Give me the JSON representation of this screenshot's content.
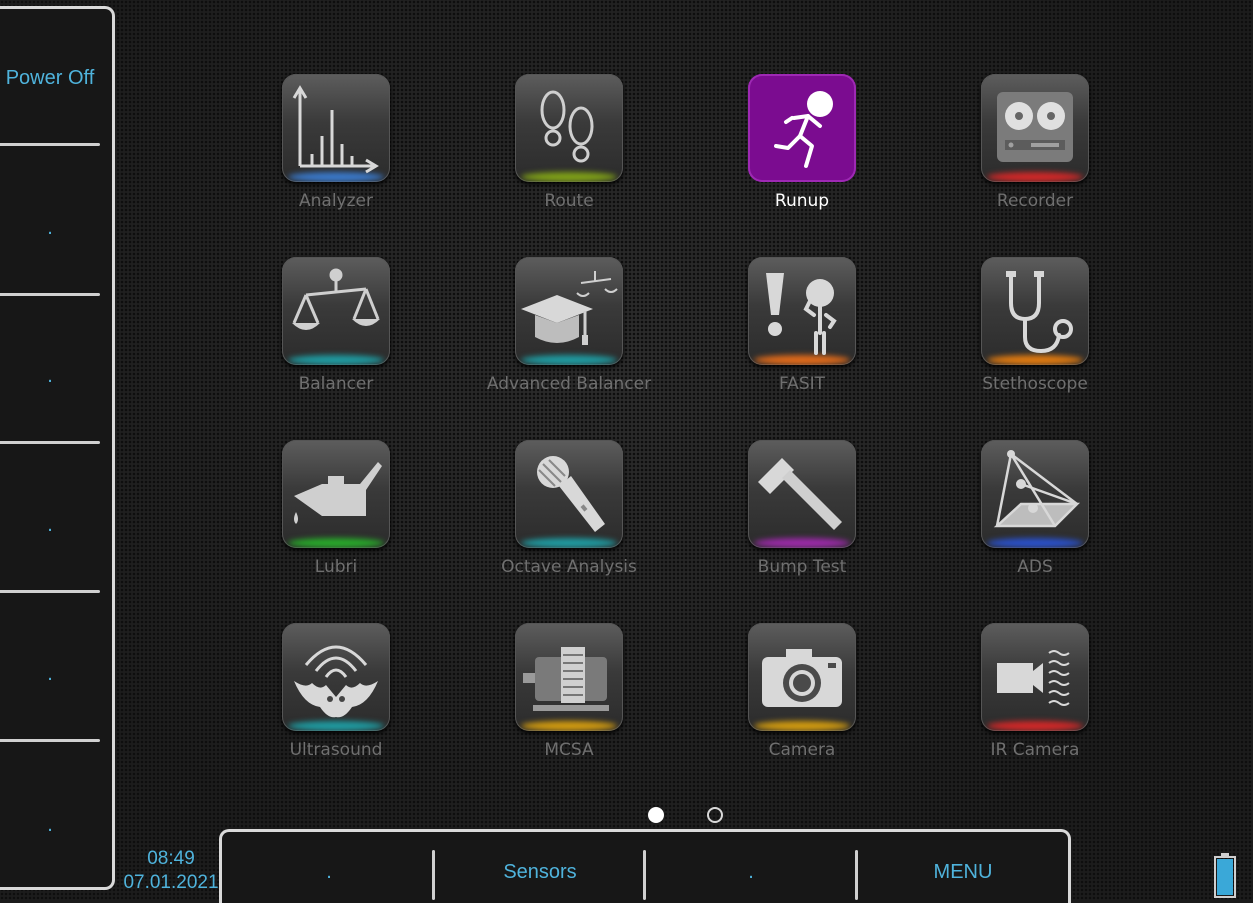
{
  "left_softkeys": [
    {
      "label": "Power Off"
    },
    {
      "label": "."
    },
    {
      "label": "."
    },
    {
      "label": "."
    },
    {
      "label": "."
    },
    {
      "label": "."
    }
  ],
  "apps": [
    {
      "label": "Analyzer",
      "icon": "spectrum-chart-icon",
      "accent": "#3a78c8",
      "active": false
    },
    {
      "label": "Route",
      "icon": "footprints-icon",
      "accent": "#7fa018",
      "active": false
    },
    {
      "label": "Runup",
      "icon": "running-man-icon",
      "accent": "#7b0c90",
      "active": true
    },
    {
      "label": "Recorder",
      "icon": "tape-recorder-icon",
      "accent": "#d02828",
      "active": false
    },
    {
      "label": "Balancer",
      "icon": "scales-icon",
      "accent": "#1f9aa0",
      "active": false
    },
    {
      "label": "Advanced Balancer",
      "icon": "graduation-cap-scales-icon",
      "accent": "#1f9aa0",
      "active": false
    },
    {
      "label": "FASIT",
      "icon": "exclamation-figure-icon",
      "accent": "#e06a1a",
      "active": false
    },
    {
      "label": "Stethoscope",
      "icon": "stethoscope-icon",
      "accent": "#e07a10",
      "active": false
    },
    {
      "label": "Lubri",
      "icon": "oil-can-icon",
      "accent": "#28a82a",
      "active": false
    },
    {
      "label": "Octave Analysis",
      "icon": "microphone-icon",
      "accent": "#1f9aa0",
      "active": false
    },
    {
      "label": "Bump Test",
      "icon": "hammer-icon",
      "accent": "#9b2aa8",
      "active": false
    },
    {
      "label": "ADS",
      "icon": "pyramid-icon",
      "accent": "#2a50c8",
      "active": false
    },
    {
      "label": "Ultrasound",
      "icon": "bat-icon",
      "accent": "#1f9aa0",
      "active": false
    },
    {
      "label": "MCSA",
      "icon": "motor-icon",
      "accent": "#d09a10",
      "active": false
    },
    {
      "label": "Camera",
      "icon": "camera-icon",
      "accent": "#d09a10",
      "active": false
    },
    {
      "label": "IR Camera",
      "icon": "ir-camera-icon",
      "accent": "#d02828",
      "active": false
    }
  ],
  "pager": {
    "current_page": 1,
    "total_pages": 2
  },
  "status": {
    "time": "08:49",
    "date": "07.01.2021",
    "battery_level": 1.0,
    "battery_color": "#3aa8d8"
  },
  "bottom_softkeys": [
    {
      "label": "."
    },
    {
      "label": "Sensors"
    },
    {
      "label": "."
    },
    {
      "label": "MENU"
    }
  ],
  "accent_color": "#4fb3dc"
}
